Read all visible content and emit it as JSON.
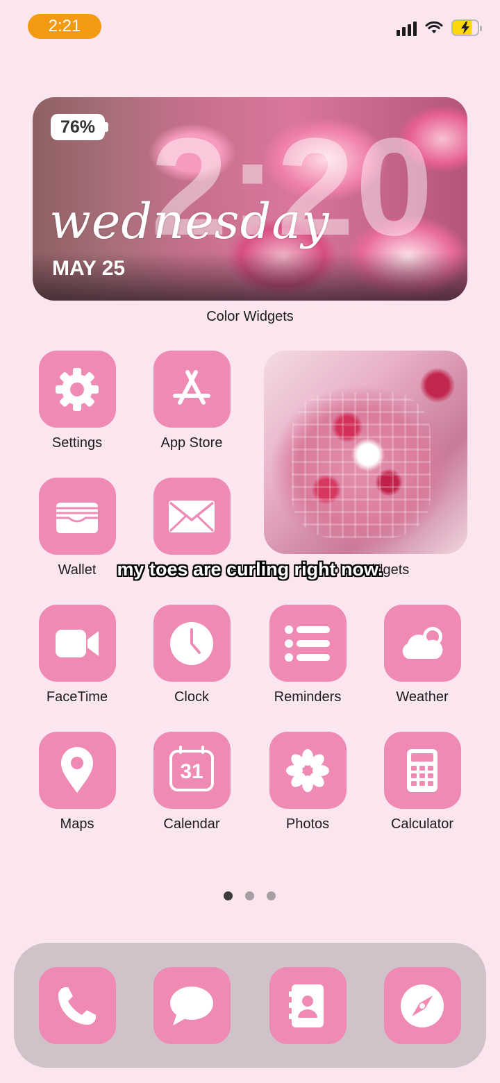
{
  "status_bar": {
    "time": "2:21"
  },
  "widget": {
    "battery_percent": "76%",
    "clock": "2:20",
    "weekday": "wednesday",
    "date": "MAY 25",
    "label": "Color Widgets"
  },
  "photo_widget": {
    "label": "Color Widgets"
  },
  "apps": [
    {
      "label": "Settings",
      "icon": "gear-icon"
    },
    {
      "label": "App Store",
      "icon": "app-store-icon"
    },
    {
      "label": "Wallet",
      "icon": "wallet-icon"
    },
    {
      "label": "Mail",
      "icon": "mail-icon"
    },
    {
      "label": "FaceTime",
      "icon": "video-camera-icon"
    },
    {
      "label": "Clock",
      "icon": "clock-icon"
    },
    {
      "label": "Reminders",
      "icon": "list-icon"
    },
    {
      "label": "Weather",
      "icon": "cloud-sun-icon"
    },
    {
      "label": "Maps",
      "icon": "map-pin-icon"
    },
    {
      "label": "Calendar",
      "icon": "calendar-icon",
      "day": "31"
    },
    {
      "label": "Photos",
      "icon": "flower-icon"
    },
    {
      "label": "Calculator",
      "icon": "calculator-icon"
    }
  ],
  "caption": "my toes are curling right now.",
  "page_dots": {
    "count": 3,
    "active_index": 0
  },
  "dock": [
    {
      "name": "Phone",
      "icon": "phone-icon"
    },
    {
      "name": "Messages",
      "icon": "message-bubble-icon"
    },
    {
      "name": "Contacts",
      "icon": "contact-icon"
    },
    {
      "name": "Safari",
      "icon": "compass-icon"
    }
  ],
  "colors": {
    "background": "#fbe6f0",
    "icon_tile": "#ee8ab4",
    "time_pill": "#f39a12"
  }
}
